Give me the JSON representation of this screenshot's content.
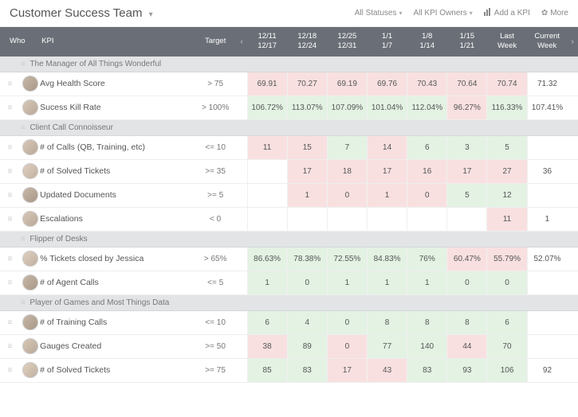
{
  "header": {
    "title": "Customer Success Team",
    "filters": {
      "statuses": "All Statuses",
      "owners": "All KPI Owners"
    },
    "add": "Add a KPI",
    "more": "More"
  },
  "columns": {
    "who": "Who",
    "kpi": "KPI",
    "target": "Target",
    "dates": [
      {
        "top": "12/11",
        "bot": "12/17"
      },
      {
        "top": "12/18",
        "bot": "12/24"
      },
      {
        "top": "12/25",
        "bot": "12/31"
      },
      {
        "top": "1/1",
        "bot": "1/7"
      },
      {
        "top": "1/8",
        "bot": "1/14"
      },
      {
        "top": "1/15",
        "bot": "1/21"
      },
      {
        "top": "Last",
        "bot": "Week"
      },
      {
        "top": "Current",
        "bot": "Week"
      }
    ]
  },
  "groups": [
    {
      "name": "The Manager of All Things Wonderful",
      "rows": [
        {
          "kpi": "Avg Health Score",
          "target": "> 75",
          "cells": [
            {
              "v": "69.91",
              "s": "r"
            },
            {
              "v": "70.27",
              "s": "r"
            },
            {
              "v": "69.19",
              "s": "r"
            },
            {
              "v": "69.76",
              "s": "r"
            },
            {
              "v": "70.43",
              "s": "r"
            },
            {
              "v": "70.64",
              "s": "r"
            },
            {
              "v": "70.74",
              "s": "r"
            },
            {
              "v": "71.32",
              "s": "e"
            }
          ]
        },
        {
          "kpi": "Sucess Kill Rate",
          "target": "> 100%",
          "cells": [
            {
              "v": "106.72%",
              "s": "g"
            },
            {
              "v": "113.07%",
              "s": "g"
            },
            {
              "v": "107.09%",
              "s": "g"
            },
            {
              "v": "101.04%",
              "s": "g"
            },
            {
              "v": "112.04%",
              "s": "g"
            },
            {
              "v": "96.27%",
              "s": "r"
            },
            {
              "v": "116.33%",
              "s": "g"
            },
            {
              "v": "107.41%",
              "s": "e"
            }
          ]
        }
      ]
    },
    {
      "name": "Client Call Connoisseur",
      "rows": [
        {
          "kpi": "# of Calls (QB, Training, etc)",
          "target": "<= 10",
          "cells": [
            {
              "v": "11",
              "s": "r"
            },
            {
              "v": "15",
              "s": "r"
            },
            {
              "v": "7",
              "s": "g"
            },
            {
              "v": "14",
              "s": "r"
            },
            {
              "v": "6",
              "s": "g"
            },
            {
              "v": "3",
              "s": "g"
            },
            {
              "v": "5",
              "s": "g"
            },
            {
              "v": "",
              "s": "e"
            }
          ]
        },
        {
          "kpi": "# of Solved Tickets",
          "target": ">= 35",
          "cells": [
            {
              "v": "",
              "s": "e"
            },
            {
              "v": "17",
              "s": "r"
            },
            {
              "v": "18",
              "s": "r"
            },
            {
              "v": "17",
              "s": "r"
            },
            {
              "v": "16",
              "s": "r"
            },
            {
              "v": "17",
              "s": "r"
            },
            {
              "v": "27",
              "s": "r"
            },
            {
              "v": "36",
              "s": "e"
            }
          ]
        },
        {
          "kpi": "Updated Documents",
          "target": ">= 5",
          "cells": [
            {
              "v": "",
              "s": "e"
            },
            {
              "v": "1",
              "s": "r"
            },
            {
              "v": "0",
              "s": "r"
            },
            {
              "v": "1",
              "s": "r"
            },
            {
              "v": "0",
              "s": "r"
            },
            {
              "v": "5",
              "s": "g"
            },
            {
              "v": "12",
              "s": "g"
            },
            {
              "v": "",
              "s": "e"
            }
          ]
        },
        {
          "kpi": "Escalations",
          "target": "< 0",
          "cells": [
            {
              "v": "",
              "s": "e"
            },
            {
              "v": "",
              "s": "e"
            },
            {
              "v": "",
              "s": "e"
            },
            {
              "v": "",
              "s": "e"
            },
            {
              "v": "",
              "s": "e"
            },
            {
              "v": "",
              "s": "e"
            },
            {
              "v": "11",
              "s": "r"
            },
            {
              "v": "1",
              "s": "e"
            }
          ]
        }
      ]
    },
    {
      "name": "Flipper of Desks",
      "rows": [
        {
          "kpi": "% Tickets closed by Jessica",
          "target": "> 65%",
          "cells": [
            {
              "v": "86.63%",
              "s": "g"
            },
            {
              "v": "78.38%",
              "s": "g"
            },
            {
              "v": "72.55%",
              "s": "g"
            },
            {
              "v": "84.83%",
              "s": "g"
            },
            {
              "v": "76%",
              "s": "g"
            },
            {
              "v": "60.47%",
              "s": "r"
            },
            {
              "v": "55.79%",
              "s": "r"
            },
            {
              "v": "52.07%",
              "s": "e"
            }
          ]
        },
        {
          "kpi": "# of Agent Calls",
          "target": "<= 5",
          "cells": [
            {
              "v": "1",
              "s": "g"
            },
            {
              "v": "0",
              "s": "g"
            },
            {
              "v": "1",
              "s": "g"
            },
            {
              "v": "1",
              "s": "g"
            },
            {
              "v": "1",
              "s": "g"
            },
            {
              "v": "0",
              "s": "g"
            },
            {
              "v": "0",
              "s": "g"
            },
            {
              "v": "",
              "s": "e"
            }
          ]
        }
      ]
    },
    {
      "name": "Player of Games and Most Things Data",
      "rows": [
        {
          "kpi": "# of Training Calls",
          "target": "<= 10",
          "cells": [
            {
              "v": "6",
              "s": "g"
            },
            {
              "v": "4",
              "s": "g"
            },
            {
              "v": "0",
              "s": "g"
            },
            {
              "v": "8",
              "s": "g"
            },
            {
              "v": "8",
              "s": "g"
            },
            {
              "v": "8",
              "s": "g"
            },
            {
              "v": "6",
              "s": "g"
            },
            {
              "v": "",
              "s": "e"
            }
          ]
        },
        {
          "kpi": "Gauges Created",
          "target": ">= 50",
          "cells": [
            {
              "v": "38",
              "s": "r"
            },
            {
              "v": "89",
              "s": "g"
            },
            {
              "v": "0",
              "s": "r"
            },
            {
              "v": "77",
              "s": "g"
            },
            {
              "v": "140",
              "s": "g"
            },
            {
              "v": "44",
              "s": "r"
            },
            {
              "v": "70",
              "s": "g"
            },
            {
              "v": "",
              "s": "e"
            }
          ]
        },
        {
          "kpi": "# of Solved Tickets",
          "target": ">= 75",
          "cells": [
            {
              "v": "85",
              "s": "g"
            },
            {
              "v": "83",
              "s": "g"
            },
            {
              "v": "17",
              "s": "r"
            },
            {
              "v": "43",
              "s": "r"
            },
            {
              "v": "83",
              "s": "g"
            },
            {
              "v": "93",
              "s": "g"
            },
            {
              "v": "106",
              "s": "g"
            },
            {
              "v": "92",
              "s": "e"
            }
          ]
        }
      ]
    }
  ]
}
